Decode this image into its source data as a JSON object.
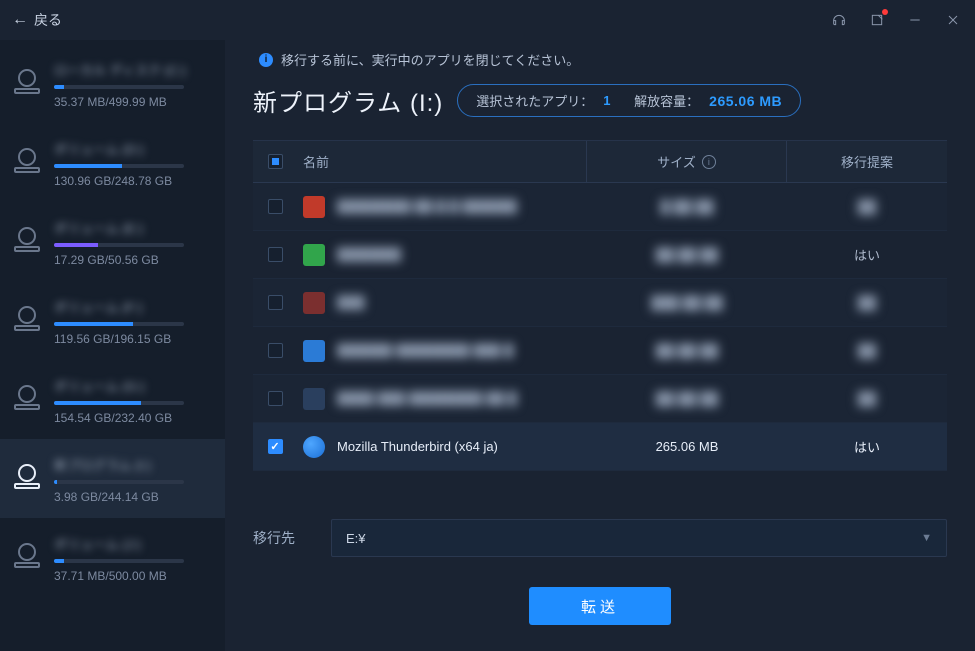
{
  "titlebar": {
    "back": "戻る"
  },
  "sidebar": {
    "drives": [
      {
        "name": "ローカル ディスク (C:)",
        "size": "35.37 MB/499.99 MB",
        "fill": 8,
        "bar": "blue",
        "active": false
      },
      {
        "name": "ボリューム (D:)",
        "size": "130.96 GB/248.78 GB",
        "fill": 52,
        "bar": "blue",
        "active": false
      },
      {
        "name": "ボリューム (E:)",
        "size": "17.29 GB/50.56 GB",
        "fill": 34,
        "bar": "purple",
        "active": false
      },
      {
        "name": "ボリューム (F:)",
        "size": "119.56 GB/196.15 GB",
        "fill": 61,
        "bar": "blue",
        "active": false
      },
      {
        "name": "ボリューム (G:)",
        "size": "154.54 GB/232.40 GB",
        "fill": 67,
        "bar": "blue",
        "active": false
      },
      {
        "name": "新プログラム (I:)",
        "size": "3.98 GB/244.14 GB",
        "fill": 2,
        "bar": "blue",
        "active": true
      },
      {
        "name": "ボリューム (J:)",
        "size": "37.71 MB/500.00 MB",
        "fill": 8,
        "bar": "blue",
        "active": false
      }
    ]
  },
  "main": {
    "notice": "移行する前に、実行中のアプリを閉じてください。",
    "heading": "新プログラム (I:)",
    "selected_label": "選択されたアプリ：",
    "selected_count": "1",
    "free_label": "解放容量：",
    "free_value": "265.06 MB",
    "columns": {
      "name": "名前",
      "size": "サイズ",
      "suggest": "移行提案"
    },
    "rows": [
      {
        "checked": false,
        "icon": "ico-red",
        "name": "████████ ██.█.█ ██████",
        "size": "█.██ ██",
        "suggest": "██",
        "blur": true
      },
      {
        "checked": false,
        "icon": "ico-green",
        "name": "███████",
        "size": "██.██ ██",
        "suggest": "はい",
        "blur": true
      },
      {
        "checked": false,
        "icon": "ico-dark",
        "name": "███",
        "size": "███.██ ██",
        "suggest": "██",
        "blur": true
      },
      {
        "checked": false,
        "icon": "ico-blue",
        "name": "██████ ████████ ███ █",
        "size": "██.██ ██",
        "suggest": "██",
        "blur": true
      },
      {
        "checked": false,
        "icon": "ico-navy",
        "name": "████ ███ ████████ ██.█",
        "size": "██.██ ██",
        "suggest": "██",
        "blur": true
      },
      {
        "checked": true,
        "icon": "ico-tb",
        "name": "Mozilla Thunderbird (x64 ja)",
        "size": "265.06 MB",
        "suggest": "はい",
        "blur": false
      }
    ],
    "dest_label": "移行先",
    "dest_value": "E:¥",
    "transfer": "転送"
  }
}
